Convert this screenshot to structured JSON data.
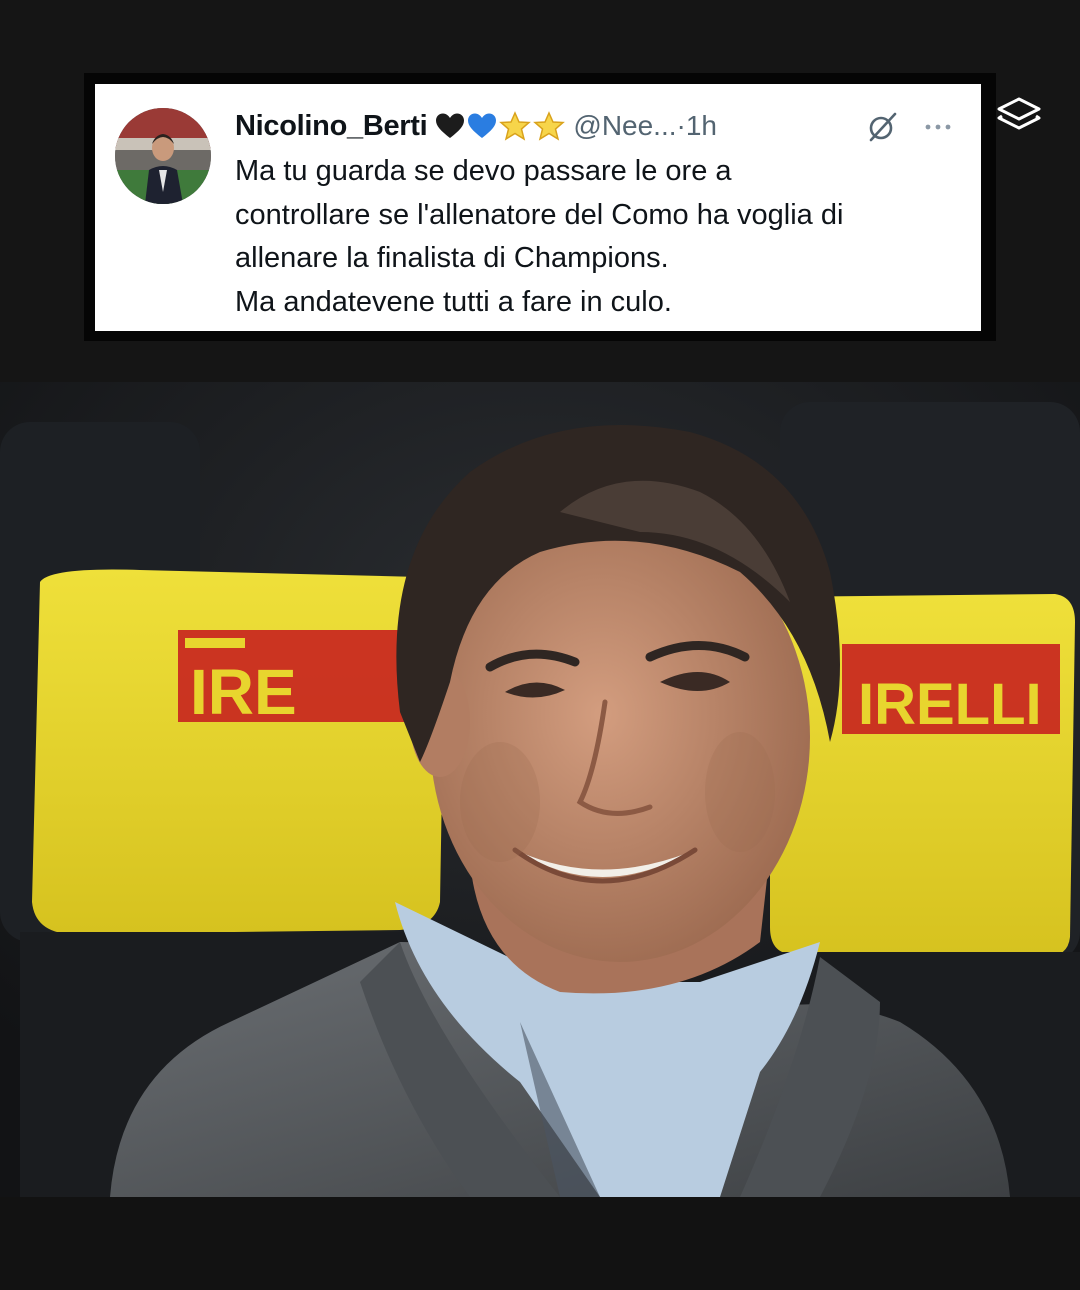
{
  "tweet": {
    "display_name": "Nicolino_Berti",
    "emoji_badges": [
      "🖤",
      "💙",
      "⭐",
      "⭐"
    ],
    "handle": "@Nee...",
    "separator": " · ",
    "time": "1h",
    "text_lines": [
      "Ma tu guarda se devo passare le ore a",
      "controllare se l'allenatore del Como ha voglia di",
      "allenare la finalista di Champions.",
      "Ma andatevene tutti a fare in culo."
    ],
    "icons": {
      "grok": "grok-icon",
      "more": "more-dots-icon"
    }
  },
  "overlay": {
    "layers_icon": "layers-icon"
  },
  "photo": {
    "seat_brand_left": "IRE",
    "seat_brand_right": "IRELLI",
    "colors": {
      "seat_yellow": "#e8d52e",
      "logo_red": "#c8261f",
      "jacket": "#55595d",
      "shirt": "#b8cce0",
      "hair": "#2f2622",
      "skin": "#c48d6e"
    }
  }
}
